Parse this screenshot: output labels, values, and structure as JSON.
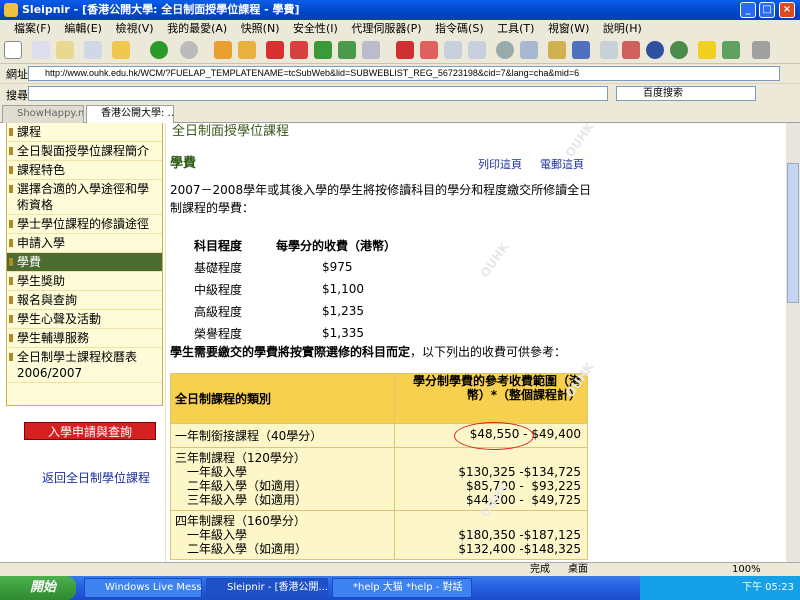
{
  "window": {
    "title": "Sleipnir - [香港公開大學: 全日制面授學位課程 - 學費]"
  },
  "menu": [
    "檔案(F)",
    "編輯(E)",
    "檢視(V)",
    "我的最愛(A)",
    "快照(N)",
    "安全性(I)",
    "代理伺服器(P)",
    "指令碼(S)",
    "工具(T)",
    "視窗(W)",
    "說明(H)"
  ],
  "address": {
    "label": "網址",
    "url": "http://www.ouhk.edu.hk/WCM/?FUELAP_TEMPLATENAME=tcSubWeb&lid=SUBWEBLIST_REG_56723198&cid=7&lang=cha&mid=6"
  },
  "search": {
    "label": "搜尋",
    "engine": "百度搜索"
  },
  "tabs": [
    {
      "label": "ShowHappy.net?..."
    },
    {
      "label": "香港公開大學: ..."
    }
  ],
  "sidebar": {
    "items": [
      "課程",
      "全日製面授學位課程簡介",
      "課程特色",
      "選擇合適的入學途徑和學術資格",
      "學士學位課程的修讀途徑",
      "申請入學",
      "學費",
      "學生獎助",
      "報名與查詢",
      "學生心聲及活動",
      "學生輔導服務",
      "全日制學士課程校曆表2006/2007"
    ],
    "apply_button": "入學申請與查詢",
    "back_link": "返回全日制學位課程"
  },
  "main": {
    "section_title": "全日制面授學位課程",
    "heading": "學費",
    "print_link": "列印這頁",
    "email_link": "電郵這頁",
    "intro": "2007－2008學年或其後入學的學生將按修讀科目的學分和程度繳交所修讀全日制課程的學費：",
    "fee_headers": [
      "科目程度",
      "每學分的收費（港幣）"
    ],
    "fee_rows": [
      [
        "基礎程度",
        "$975"
      ],
      [
        "中級程度",
        "$1,100"
      ],
      [
        "高級程度",
        "$1,235"
      ],
      [
        "榮譽程度",
        "$1,335"
      ]
    ],
    "note_bold": "學生需要繳交的學費將按實際選修的科目而定",
    "note_rest": "，以下列出的收費可供參考：",
    "range_headers": [
      "全日制課程的類別",
      "學分制學費的參考收費範圍（港幣）*（整個課程計）"
    ],
    "range_rows": [
      {
        "program": "一年制銜接課程（40學分）",
        "fee": "$48,550 - $49,400"
      },
      {
        "program": "三年制課程（120學分）\n　一年級入學\n　二年級入學（如適用）\n　三年級入學（如適用）",
        "fee": "\n$130,325 -$134,725\n$85,700 -  $93,225\n$44,200 -  $49,725"
      },
      {
        "program": "四年制課程（160學分）\n　一年級入學\n　二年級入學（如適用）",
        "fee": "\n$180,350 -$187,125\n$132,400 -$148,325"
      }
    ],
    "watermark": "OUHK"
  },
  "statusbar": {
    "status": "完成",
    "desktop": "桌面",
    "zoom": "100%"
  },
  "taskbar": {
    "start": "開始",
    "tasks": [
      "Windows Live Messen...",
      "Sleipnir - [香港公開...",
      "*help 大猫 *help - 對話"
    ],
    "clock": "下午 05:23"
  }
}
